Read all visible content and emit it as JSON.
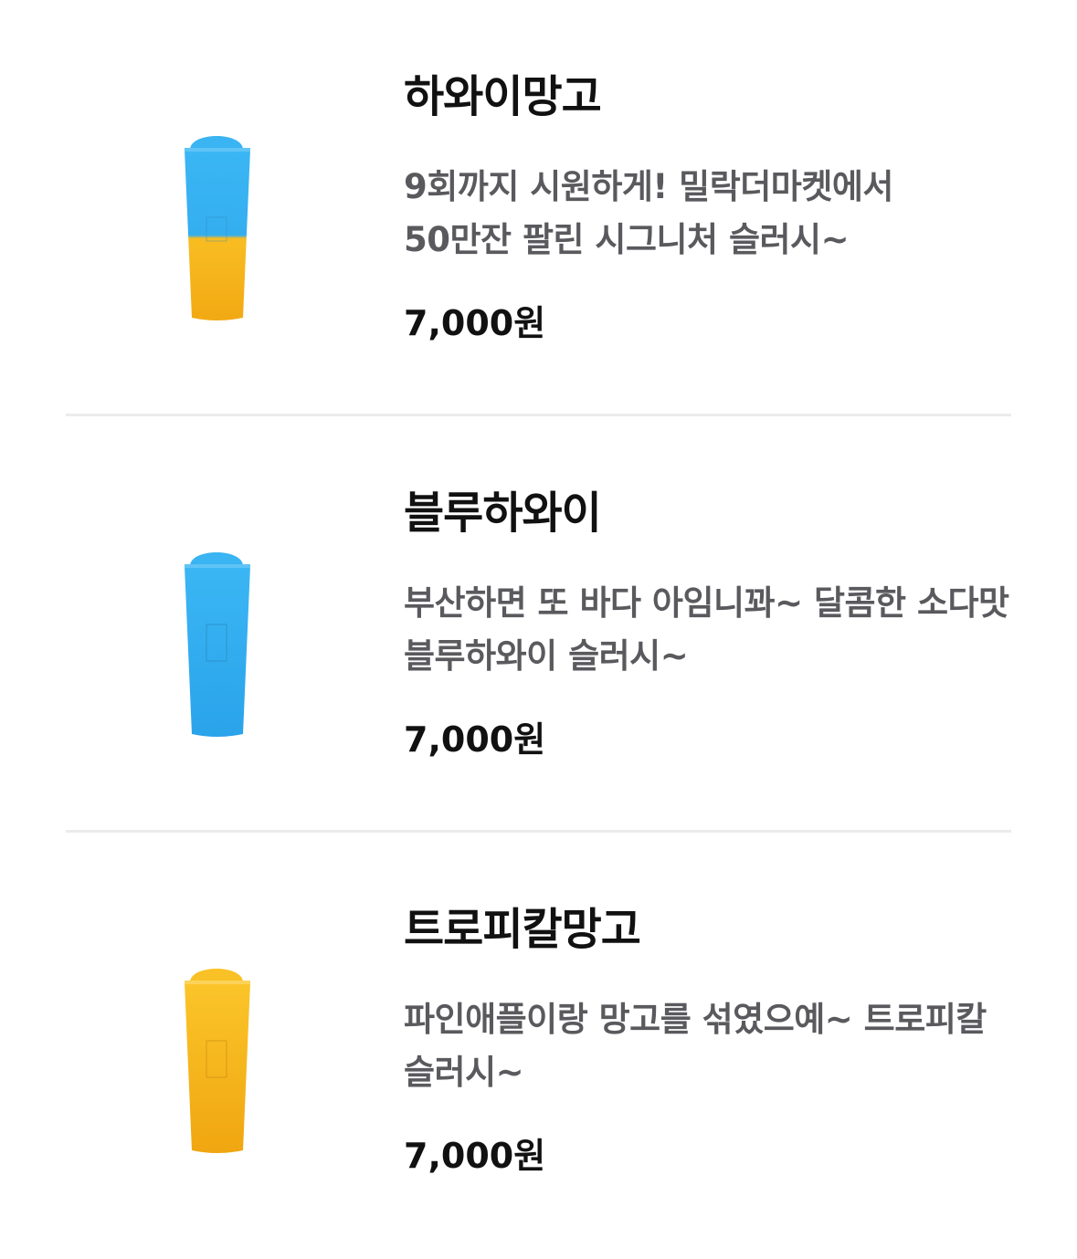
{
  "menu": {
    "items": [
      {
        "name": "하와이망고",
        "description": "9회까지 시원하게! 밀락더마켓에서 50만잔 팔린 시그니처 슬러시~",
        "price": "7,000원",
        "image_icon": "blue-yellow-slush-cup-icon",
        "colors": {
          "top": "#33aef0",
          "bottom": "#f7b21c"
        }
      },
      {
        "name": "블루하와이",
        "description": "부산하면 또 바다 아임니꽈~ 달콤한 소다맛 블루하와이 슬러시~",
        "price": "7,000원",
        "image_icon": "blue-slush-cup-icon",
        "colors": {
          "top": "#2fabef",
          "bottom": "#2fabef"
        }
      },
      {
        "name": "트로피칼망고",
        "description": "파인애플이랑 망고를 섞였으예~ 트로피칼 슬러시~",
        "price": "7,000원",
        "image_icon": "yellow-slush-cup-icon",
        "colors": {
          "top": "#f7b21c",
          "bottom": "#f7b21c"
        }
      }
    ]
  }
}
